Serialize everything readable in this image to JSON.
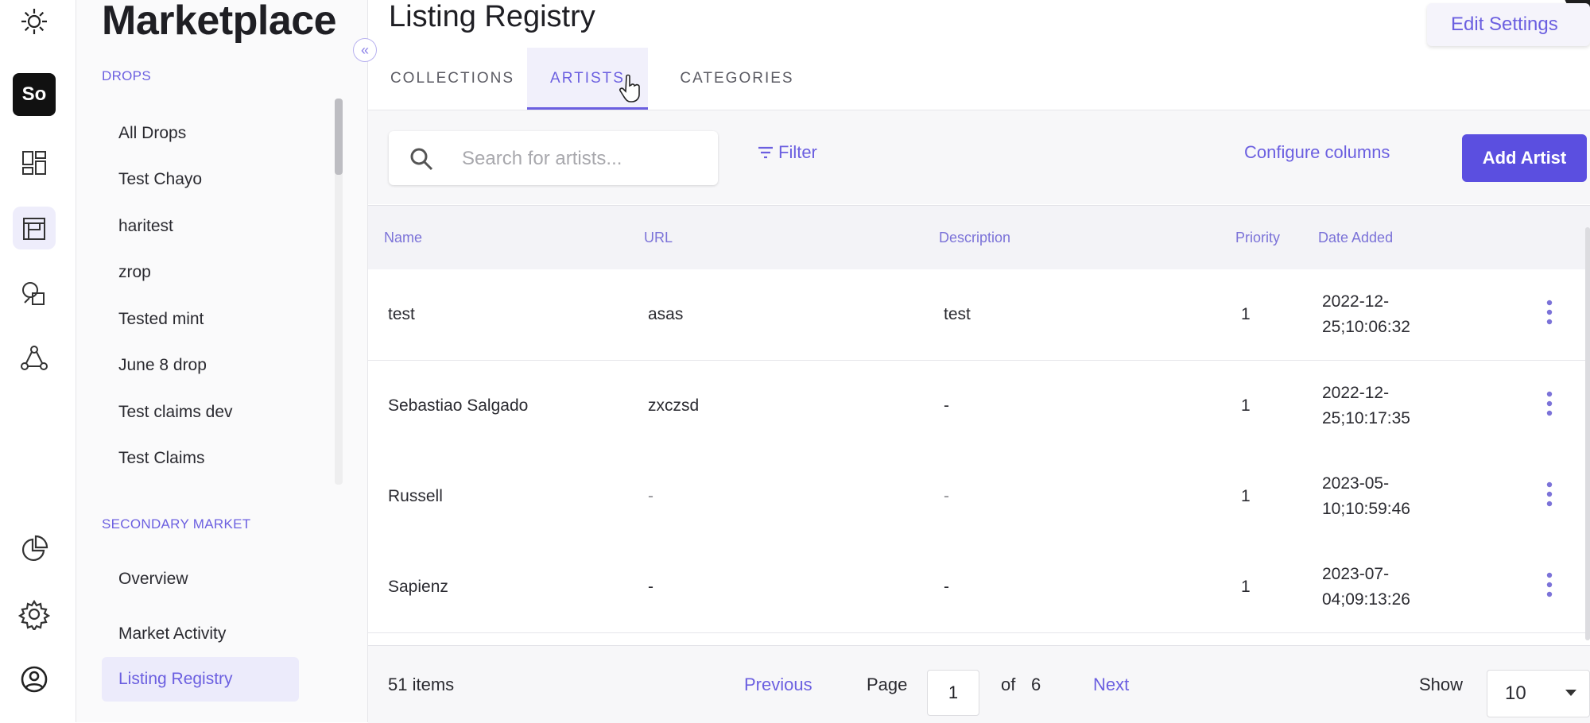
{
  "rail": {
    "badge": "So",
    "icons": [
      "brand-logo-icon",
      "dashboard-icon",
      "storefront-icon",
      "design-icon",
      "network-icon",
      "analytics-icon",
      "settings-icon",
      "account-icon"
    ]
  },
  "sidebar": {
    "title": "Marketplace",
    "drops_heading": "DROPS",
    "drops": [
      "All Drops",
      "Test Chayo",
      "haritest",
      "zrop",
      "Tested mint",
      "June 8 drop",
      "Test claims dev",
      "Test Claims"
    ],
    "secondary_heading": "SECONDARY MARKET",
    "secondary": [
      "Overview",
      "Market Activity",
      "Listing Registry"
    ],
    "collapse_glyph": "«"
  },
  "header": {
    "title": "Listing Registry",
    "edit_settings": "Edit Settings"
  },
  "tabs": [
    {
      "label": "COLLECTIONS",
      "active": false
    },
    {
      "label": "ARTISTS",
      "active": true
    },
    {
      "label": "CATEGORIES",
      "active": false
    }
  ],
  "toolbar": {
    "search_placeholder": "Search for artists...",
    "filter": "Filter",
    "configure_columns": "Configure columns",
    "add_artist": "Add Artist"
  },
  "table": {
    "columns": [
      "Name",
      "URL",
      "Description",
      "Priority",
      "Date Added"
    ],
    "rows": [
      {
        "name": "test",
        "url": "asas",
        "description": "test",
        "priority": "1",
        "date_line1": "2022-12-",
        "date_line2": "25;10:06:32"
      },
      {
        "name": "Sebastiao Salgado",
        "url": "zxczsd",
        "description": "-",
        "priority": "1",
        "date_line1": "2022-12-",
        "date_line2": "25;10:17:35"
      },
      {
        "name": "Russell",
        "url": "-",
        "description": "-",
        "priority": "1",
        "date_line1": "2023-05-",
        "date_line2": "10;10:59:46"
      },
      {
        "name": "Sapienz",
        "url": "-",
        "description": "-",
        "priority": "1",
        "date_line1": "2023-07-",
        "date_line2": "04;09:13:26"
      }
    ]
  },
  "pagination": {
    "items": "51 items",
    "previous": "Previous",
    "page_label": "Page",
    "page": "1",
    "of_label": "of",
    "total_pages": "6",
    "next": "Next",
    "show_label": "Show",
    "page_size": "10"
  },
  "colors": {
    "accent": "#6b5fe0",
    "button": "#5b4fe0"
  }
}
